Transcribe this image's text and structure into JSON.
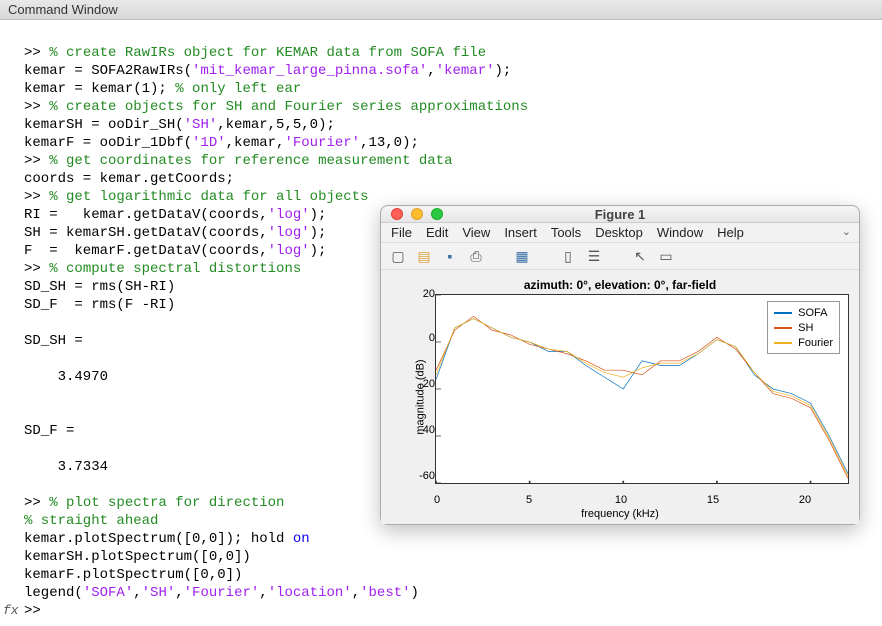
{
  "window_title": "Command Window",
  "prompt": ">>",
  "code": {
    "c1": "% create RawIRs object for KEMAR data from SOFA file",
    "l2a": "kemar = SOFA2RawIRs(",
    "l2s1": "'mit_kemar_large_pinna.sofa'",
    "l2s2": "'kemar'",
    "l2b": ");",
    "l3a": "kemar = kemar(1); ",
    "c3": "% only left ear",
    "c4": "% create objects for SH and Fourier series approximations",
    "l5a": "kemarSH = ooDir_SH(",
    "l5s": "'SH'",
    "l5b": ",kemar,5,5,0);",
    "l6a": "kemarF = ooDir_1Dbf(",
    "l6s1": "'1D'",
    "l6m": ",kemar,",
    "l6s2": "'Fourier'",
    "l6b": ",13,0);",
    "c7": "% get coordinates for reference measurement data",
    "l8": "coords = kemar.getCoords;",
    "c9": "% get logarithmic data for all objects",
    "l10a": "RI =   kemar.getDataV(coords,",
    "l10s": "'log'",
    "l10b": ");",
    "l11a": "SH = kemarSH.getDataV(coords,",
    "l11s": "'log'",
    "l11b": ");",
    "l12a": "F  =  kemarF.getDataV(coords,",
    "l12s": "'log'",
    "l12b": ");",
    "c13": "% compute spectral distortions",
    "l14": "SD_SH = rms(SH-RI)",
    "l15": "SD_F  = rms(F -RI)",
    "o1": "SD_SH =",
    "o1v": "    3.4970",
    "o2": "SD_F =",
    "o2v": "    3.7334",
    "c20": "% plot spectra for direction",
    "c21": "% straight ahead",
    "l22a": "kemar.plotSpectrum([0,0]); hold ",
    "l22kw": "on",
    "l23": "kemarSH.plotSpectrum([0,0])",
    "l24": "kemarF.plotSpectrum([0,0])",
    "l25a": "legend(",
    "l25s1": "'SOFA'",
    "l25s2": "'SH'",
    "l25s3": "'Fourier'",
    "l25s4": "'location'",
    "l25s5": "'best'",
    "l25b": ")"
  },
  "figure": {
    "title": "Figure 1",
    "menu": [
      "File",
      "Edit",
      "View",
      "Insert",
      "Tools",
      "Desktop",
      "Window",
      "Help"
    ],
    "plot_title": "azimuth: 0°, elevation: 0°, far-field",
    "xlabel": "frequency (kHz)",
    "ylabel": "magnitude (dB)",
    "legend": [
      "SOFA",
      "SH",
      "Fourier"
    ],
    "colors": {
      "SOFA": "#0072bd",
      "SH": "#d95319",
      "Fourier": "#edb120"
    },
    "yticks": [
      "20",
      "0",
      "-20",
      "-40",
      "-60"
    ],
    "xticks": [
      "0",
      "5",
      "10",
      "15",
      "20"
    ]
  },
  "chart_data": {
    "type": "line",
    "title": "azimuth: 0°, elevation: 0°, far-field",
    "xlabel": "frequency (kHz)",
    "ylabel": "magnitude (dB)",
    "xlim": [
      0,
      22
    ],
    "ylim": [
      -60,
      20
    ],
    "x": [
      0,
      1,
      2,
      3,
      4,
      5,
      6,
      7,
      8,
      9,
      10,
      11,
      12,
      13,
      14,
      15,
      16,
      17,
      18,
      19,
      20,
      21,
      22
    ],
    "series": [
      {
        "name": "SOFA",
        "color": "#0072bd",
        "values": [
          -16,
          6,
          10,
          6,
          2,
          0,
          -4,
          -4,
          -10,
          -15,
          -20,
          -8,
          -10,
          -10,
          -5,
          1,
          -2,
          -14,
          -20,
          -22,
          -26,
          -40,
          -56
        ]
      },
      {
        "name": "SH",
        "color": "#d95319",
        "values": [
          -12,
          5,
          11,
          5,
          3,
          -1,
          -3,
          -5,
          -8,
          -12,
          -12,
          -14,
          -8,
          -8,
          -4,
          2,
          -3,
          -13,
          -22,
          -24,
          -28,
          -42,
          -58
        ]
      },
      {
        "name": "Fourier",
        "color": "#edb120",
        "values": [
          -14,
          6,
          10,
          6,
          2,
          0,
          -3,
          -4,
          -9,
          -13,
          -15,
          -11,
          -9,
          -9,
          -5,
          1,
          -2,
          -13,
          -21,
          -23,
          -27,
          -41,
          -57
        ]
      }
    ]
  }
}
